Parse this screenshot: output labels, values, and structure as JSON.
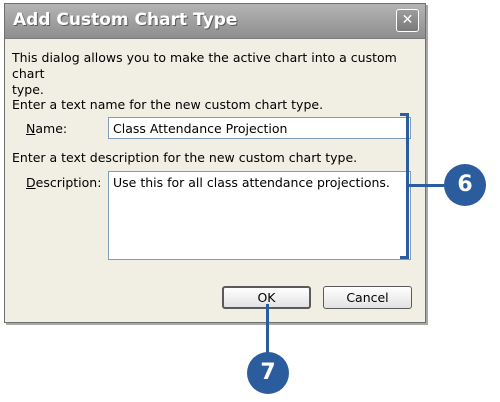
{
  "dialog": {
    "title": "Add Custom Chart Type",
    "intro_line1": "This dialog allows you to make the active chart into a custom chart",
    "intro_line2": "type.",
    "name_prompt": "Enter a text name for the new custom chart type.",
    "name_label_u": "N",
    "name_label_rest": "ame:",
    "name_value": "Class Attendance Projection",
    "desc_prompt": "Enter a text description for the new custom chart type.",
    "desc_label_u": "D",
    "desc_label_rest": "escription:",
    "desc_value": "Use this for all class attendance projections.",
    "ok_label": "OK",
    "cancel_label": "Cancel",
    "close_glyph": "✕"
  },
  "callouts": {
    "step6": "6",
    "step7": "7",
    "color": "#2a5c9e"
  }
}
